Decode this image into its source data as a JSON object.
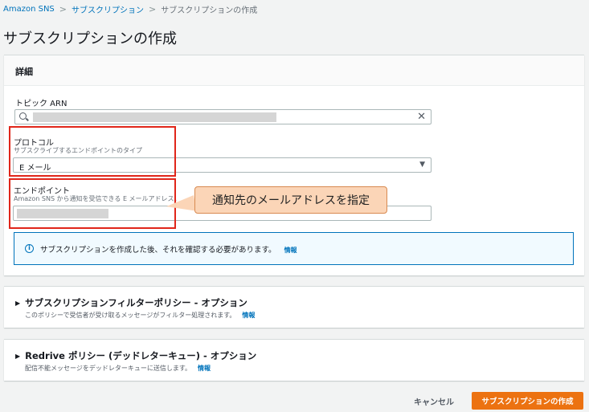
{
  "breadcrumb": {
    "items": [
      "Amazon SNS",
      "サブスクリプション",
      "サブスクリプションの作成"
    ]
  },
  "page": {
    "title": "サブスクリプションの作成"
  },
  "details": {
    "header": "詳細",
    "topic_arn": {
      "label": "トピック ARN"
    },
    "protocol": {
      "label": "プロトコル",
      "description": "サブスクライブするエンドポイントのタイプ",
      "value": "E メール"
    },
    "endpoint": {
      "label": "エンドポイント",
      "description": "Amazon SNS から通知を受信できる E メールアドレス。"
    },
    "callout": "通知先のメールアドレスを指定",
    "info": {
      "text": "サブスクリプションを作成した後、それを確認する必要があります。",
      "link": "情報"
    }
  },
  "filter_policy": {
    "title": "サブスクリプションフィルターポリシー - オプション",
    "description": "このポリシーで受信者が受け取るメッセージがフィルター処理されます。",
    "link": "情報"
  },
  "redrive_policy": {
    "title": "Redrive ポリシー (デッドレターキュー) - オプション",
    "description": "配信不能メッセージをデッドレターキューに送信します。",
    "link": "情報"
  },
  "actions": {
    "cancel": "キャンセル",
    "create": "サブスクリプションの作成"
  },
  "colors": {
    "primary_button": "#ec7211",
    "link": "#0073bb",
    "highlight_border": "#e0261a",
    "callout_bg": "#fbd5b7"
  }
}
